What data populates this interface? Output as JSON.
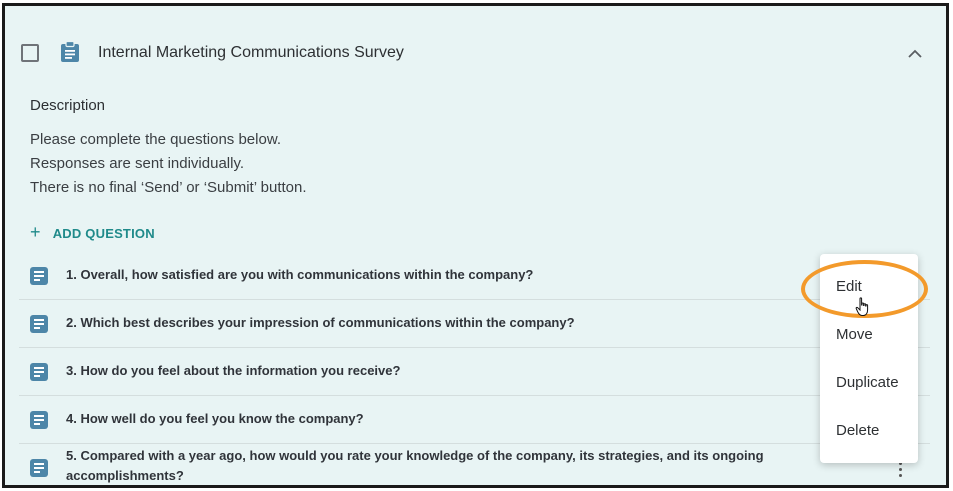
{
  "survey": {
    "title": "Internal Marketing Communications Survey",
    "description_heading": "Description",
    "description_lines": [
      "Please complete the questions below.",
      "Responses are sent individually.",
      "There is no final ‘Send’ or ‘Submit’ button."
    ],
    "add_question_label": "ADD QUESTION",
    "add_icon": "+"
  },
  "questions": [
    {
      "text": "1. Overall, how satisfied are you with communications within the company?"
    },
    {
      "text": "2. Which best describes your impression of communications within the company?"
    },
    {
      "text": "3. How do you feel about the information you receive?"
    },
    {
      "text": "4. How well do you feel you know the company?"
    },
    {
      "text": "5. Compared with a year ago, how would you rate your knowledge of the company, its strategies, and its ongoing accomplishments?"
    }
  ],
  "context_menu": {
    "items": [
      "Edit",
      "Move",
      "Duplicate",
      "Delete"
    ],
    "highlighted_item": "Edit",
    "highlight_color": "#f39a2b"
  },
  "icons": {
    "header": "clipboard-icon",
    "question": "text-question-icon",
    "collapse": "chevron-up-icon",
    "more": "more-vertical-icon",
    "cursor": "hand-pointer-icon"
  },
  "colors": {
    "panel_background": "#e8f4f4",
    "accent": "#1f8a8a",
    "question_icon": "#4d86a8"
  }
}
